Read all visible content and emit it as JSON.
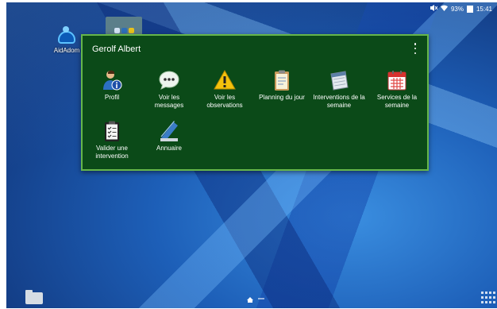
{
  "status_bar": {
    "battery": "93%",
    "time": "15:41"
  },
  "desktop": {
    "app_label": "AidAdom"
  },
  "widget": {
    "title": "Gerolf Albert",
    "tiles": [
      {
        "label": "Profil",
        "icon": "user-profile-icon"
      },
      {
        "label": "Voir les messages",
        "icon": "speech-bubble-icon"
      },
      {
        "label": "Voir les observations",
        "icon": "warning-icon"
      },
      {
        "label": "Planning du jour",
        "icon": "clipboard-icon"
      },
      {
        "label": "Interventions de la semaine",
        "icon": "calendar-icon"
      },
      {
        "label": "Services de la semaine",
        "icon": "calendar-grid-icon"
      },
      {
        "label": "Valider une intervention",
        "icon": "checklist-icon"
      },
      {
        "label": "Annuaire",
        "icon": "directory-book-icon"
      }
    ]
  },
  "colors": {
    "widget_bg": "#0b4a18",
    "widget_border": "#66b64a"
  }
}
